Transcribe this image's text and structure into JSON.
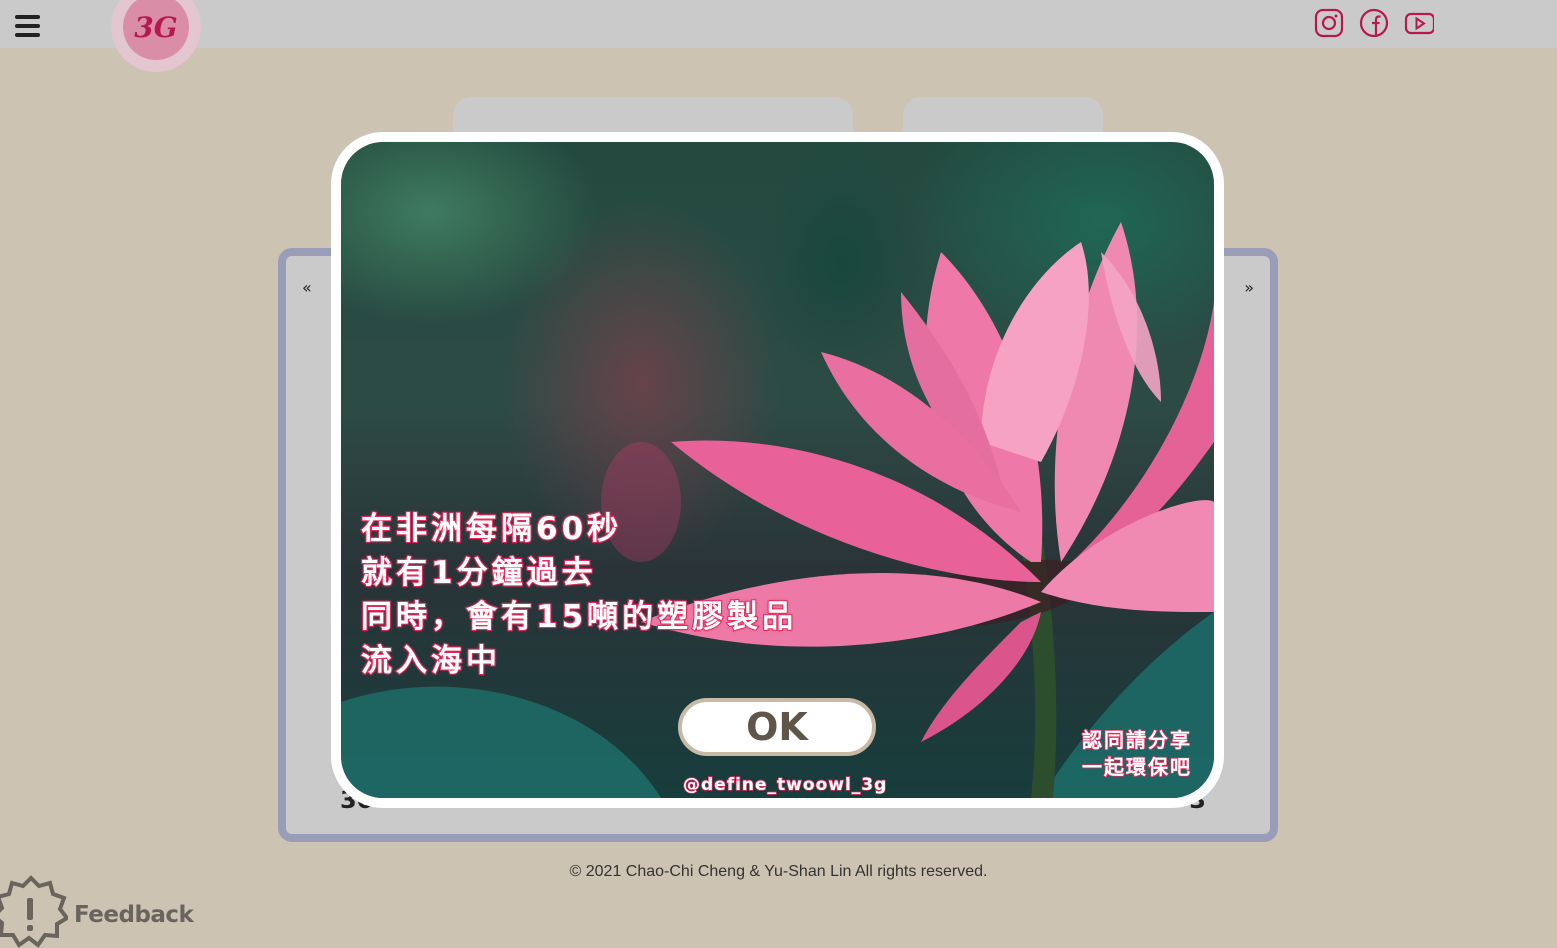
{
  "header": {
    "logo_text": "3G",
    "menu_icon": "hamburger-icon",
    "social": [
      {
        "name": "instagram",
        "icon": "instagram-icon"
      },
      {
        "name": "facebook",
        "icon": "facebook-icon"
      },
      {
        "name": "youtube",
        "icon": "youtube-icon"
      }
    ]
  },
  "carousel": {
    "prev_label": "«",
    "next_label": "»",
    "partial_left_text": "30",
    "partial_right_text": "3"
  },
  "modal": {
    "message_lines": [
      "在非洲每隔60秒",
      "就有1分鐘過去",
      "同時，會有15噸的塑膠製品",
      "流入海中"
    ],
    "ok_label": "OK",
    "handle": "@define_twoowl_3g",
    "share_lines": [
      "認同請分享",
      "一起環保吧"
    ]
  },
  "footer": {
    "copyright": "© 2021 Chao-Chi Cheng & Yu-Shan Lin All rights reserved."
  },
  "feedback": {
    "label": "Feedback",
    "icon": "alert-badge-icon"
  },
  "colors": {
    "page_bg": "#cdc3b3",
    "topbar_bg": "#cbcacb",
    "panel_border": "#9a9db8",
    "brand_pink": "#b61950",
    "text_outline": "#e52c5e",
    "ok_border": "#c7b9a4"
  }
}
